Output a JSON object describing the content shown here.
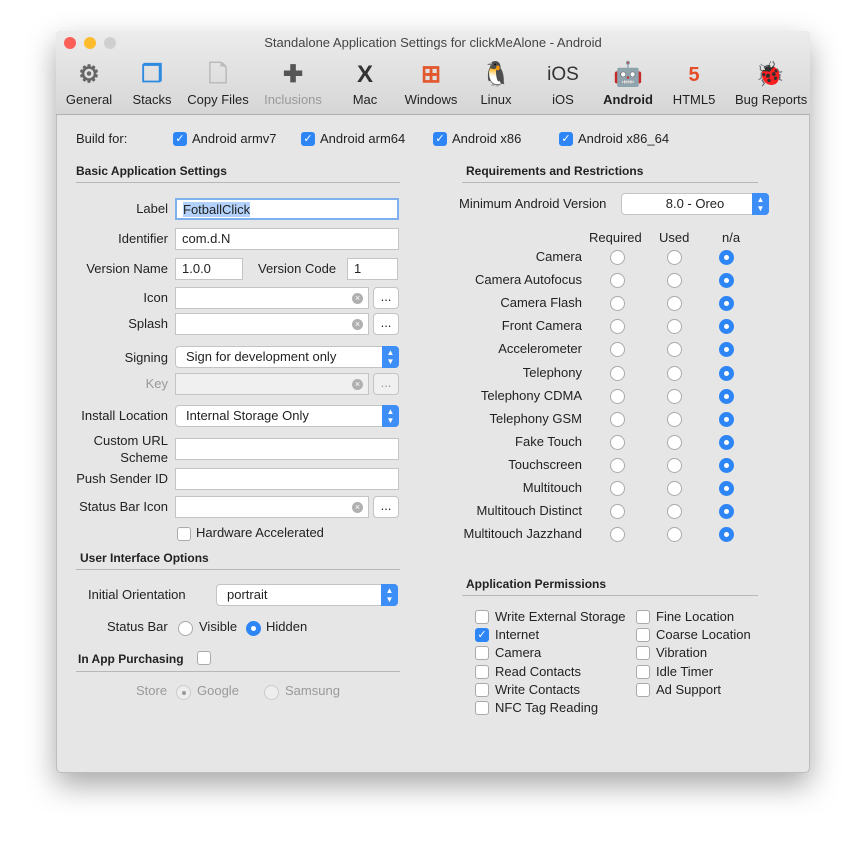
{
  "window": {
    "title": "Standalone Application Settings for clickMeAlone - Android"
  },
  "toolbar": [
    {
      "label": "General",
      "icon": "gear-icon"
    },
    {
      "label": "Stacks",
      "icon": "stacks-icon"
    },
    {
      "label": "Copy Files",
      "icon": "files-icon"
    },
    {
      "label": "Inclusions",
      "icon": "puzzle-icon"
    },
    {
      "label": "Mac",
      "icon": "mac-x-icon"
    },
    {
      "label": "Windows",
      "icon": "windows-icon"
    },
    {
      "label": "Linux",
      "icon": "penguin-icon"
    },
    {
      "label": "iOS",
      "icon": "ios-icon"
    },
    {
      "label": "Android",
      "icon": "android-icon"
    },
    {
      "label": "HTML5",
      "icon": "html5-icon"
    },
    {
      "label": "Bug Reports",
      "icon": "bug-icon"
    }
  ],
  "build": {
    "label": "Build for:",
    "targets": [
      {
        "label": "Android armv7",
        "checked": true
      },
      {
        "label": "Android arm64",
        "checked": true
      },
      {
        "label": "Android x86",
        "checked": true
      },
      {
        "label": "Android x86_64",
        "checked": true
      }
    ]
  },
  "basic": {
    "heading": "Basic Application Settings",
    "label_l": "Label",
    "label_v": "FotballClick",
    "identifier_l": "Identifier",
    "identifier_v": "com.d.N",
    "version_name_l": "Version Name",
    "version_name_v": "1.0.0",
    "version_code_l": "Version Code",
    "version_code_v": "1",
    "icon_l": "Icon",
    "splash_l": "Splash",
    "browse": "...",
    "signing_l": "Signing",
    "signing_v": "Sign for development only",
    "key_l": "Key",
    "install_l": "Install Location",
    "install_v": "Internal Storage Only",
    "url_l1": "Custom URL",
    "url_l2": "Scheme",
    "push_l": "Push Sender ID",
    "statusicon_l": "Status Bar Icon",
    "hw_l": "Hardware Accelerated"
  },
  "ui": {
    "heading": "User Interface Options",
    "orientation_l": "Initial Orientation",
    "orientation_v": "portrait",
    "statusbar_l": "Status Bar",
    "visible": "Visible",
    "hidden": "Hidden",
    "iap_l": "In App Purchasing",
    "store_l": "Store",
    "google": "Google",
    "samsung": "Samsung"
  },
  "req": {
    "heading": "Requirements and Restrictions",
    "minver_l": "Minimum Android Version",
    "minver_v": "8.0 - Oreo",
    "cols": [
      "Required",
      "Used",
      "n/a"
    ],
    "items": [
      {
        "label": "Camera",
        "value": "n/a"
      },
      {
        "label": "Camera Autofocus",
        "value": "n/a"
      },
      {
        "label": "Camera Flash",
        "value": "n/a"
      },
      {
        "label": "Front Camera",
        "value": "n/a"
      },
      {
        "label": "Accelerometer",
        "value": "n/a"
      },
      {
        "label": "Telephony",
        "value": "n/a"
      },
      {
        "label": "Telephony CDMA",
        "value": "n/a"
      },
      {
        "label": "Telephony GSM",
        "value": "n/a"
      },
      {
        "label": "Fake Touch",
        "value": "n/a"
      },
      {
        "label": "Touchscreen",
        "value": "n/a"
      },
      {
        "label": "Multitouch",
        "value": "n/a"
      },
      {
        "label": "Multitouch Distinct",
        "value": "n/a"
      },
      {
        "label": "Multitouch Jazzhand",
        "value": "n/a"
      }
    ]
  },
  "perm": {
    "heading": "Application Permissions",
    "col1": [
      {
        "label": "Write External Storage",
        "checked": false
      },
      {
        "label": "Internet",
        "checked": true
      },
      {
        "label": "Camera",
        "checked": false
      },
      {
        "label": "Read Contacts",
        "checked": false
      },
      {
        "label": "Write Contacts",
        "checked": false
      },
      {
        "label": "NFC Tag Reading",
        "checked": false
      }
    ],
    "col2": [
      {
        "label": "Fine Location",
        "checked": false
      },
      {
        "label": "Coarse Location",
        "checked": false
      },
      {
        "label": "Vibration",
        "checked": false
      },
      {
        "label": "Idle Timer",
        "checked": false
      },
      {
        "label": "Ad Support",
        "checked": false
      }
    ]
  }
}
